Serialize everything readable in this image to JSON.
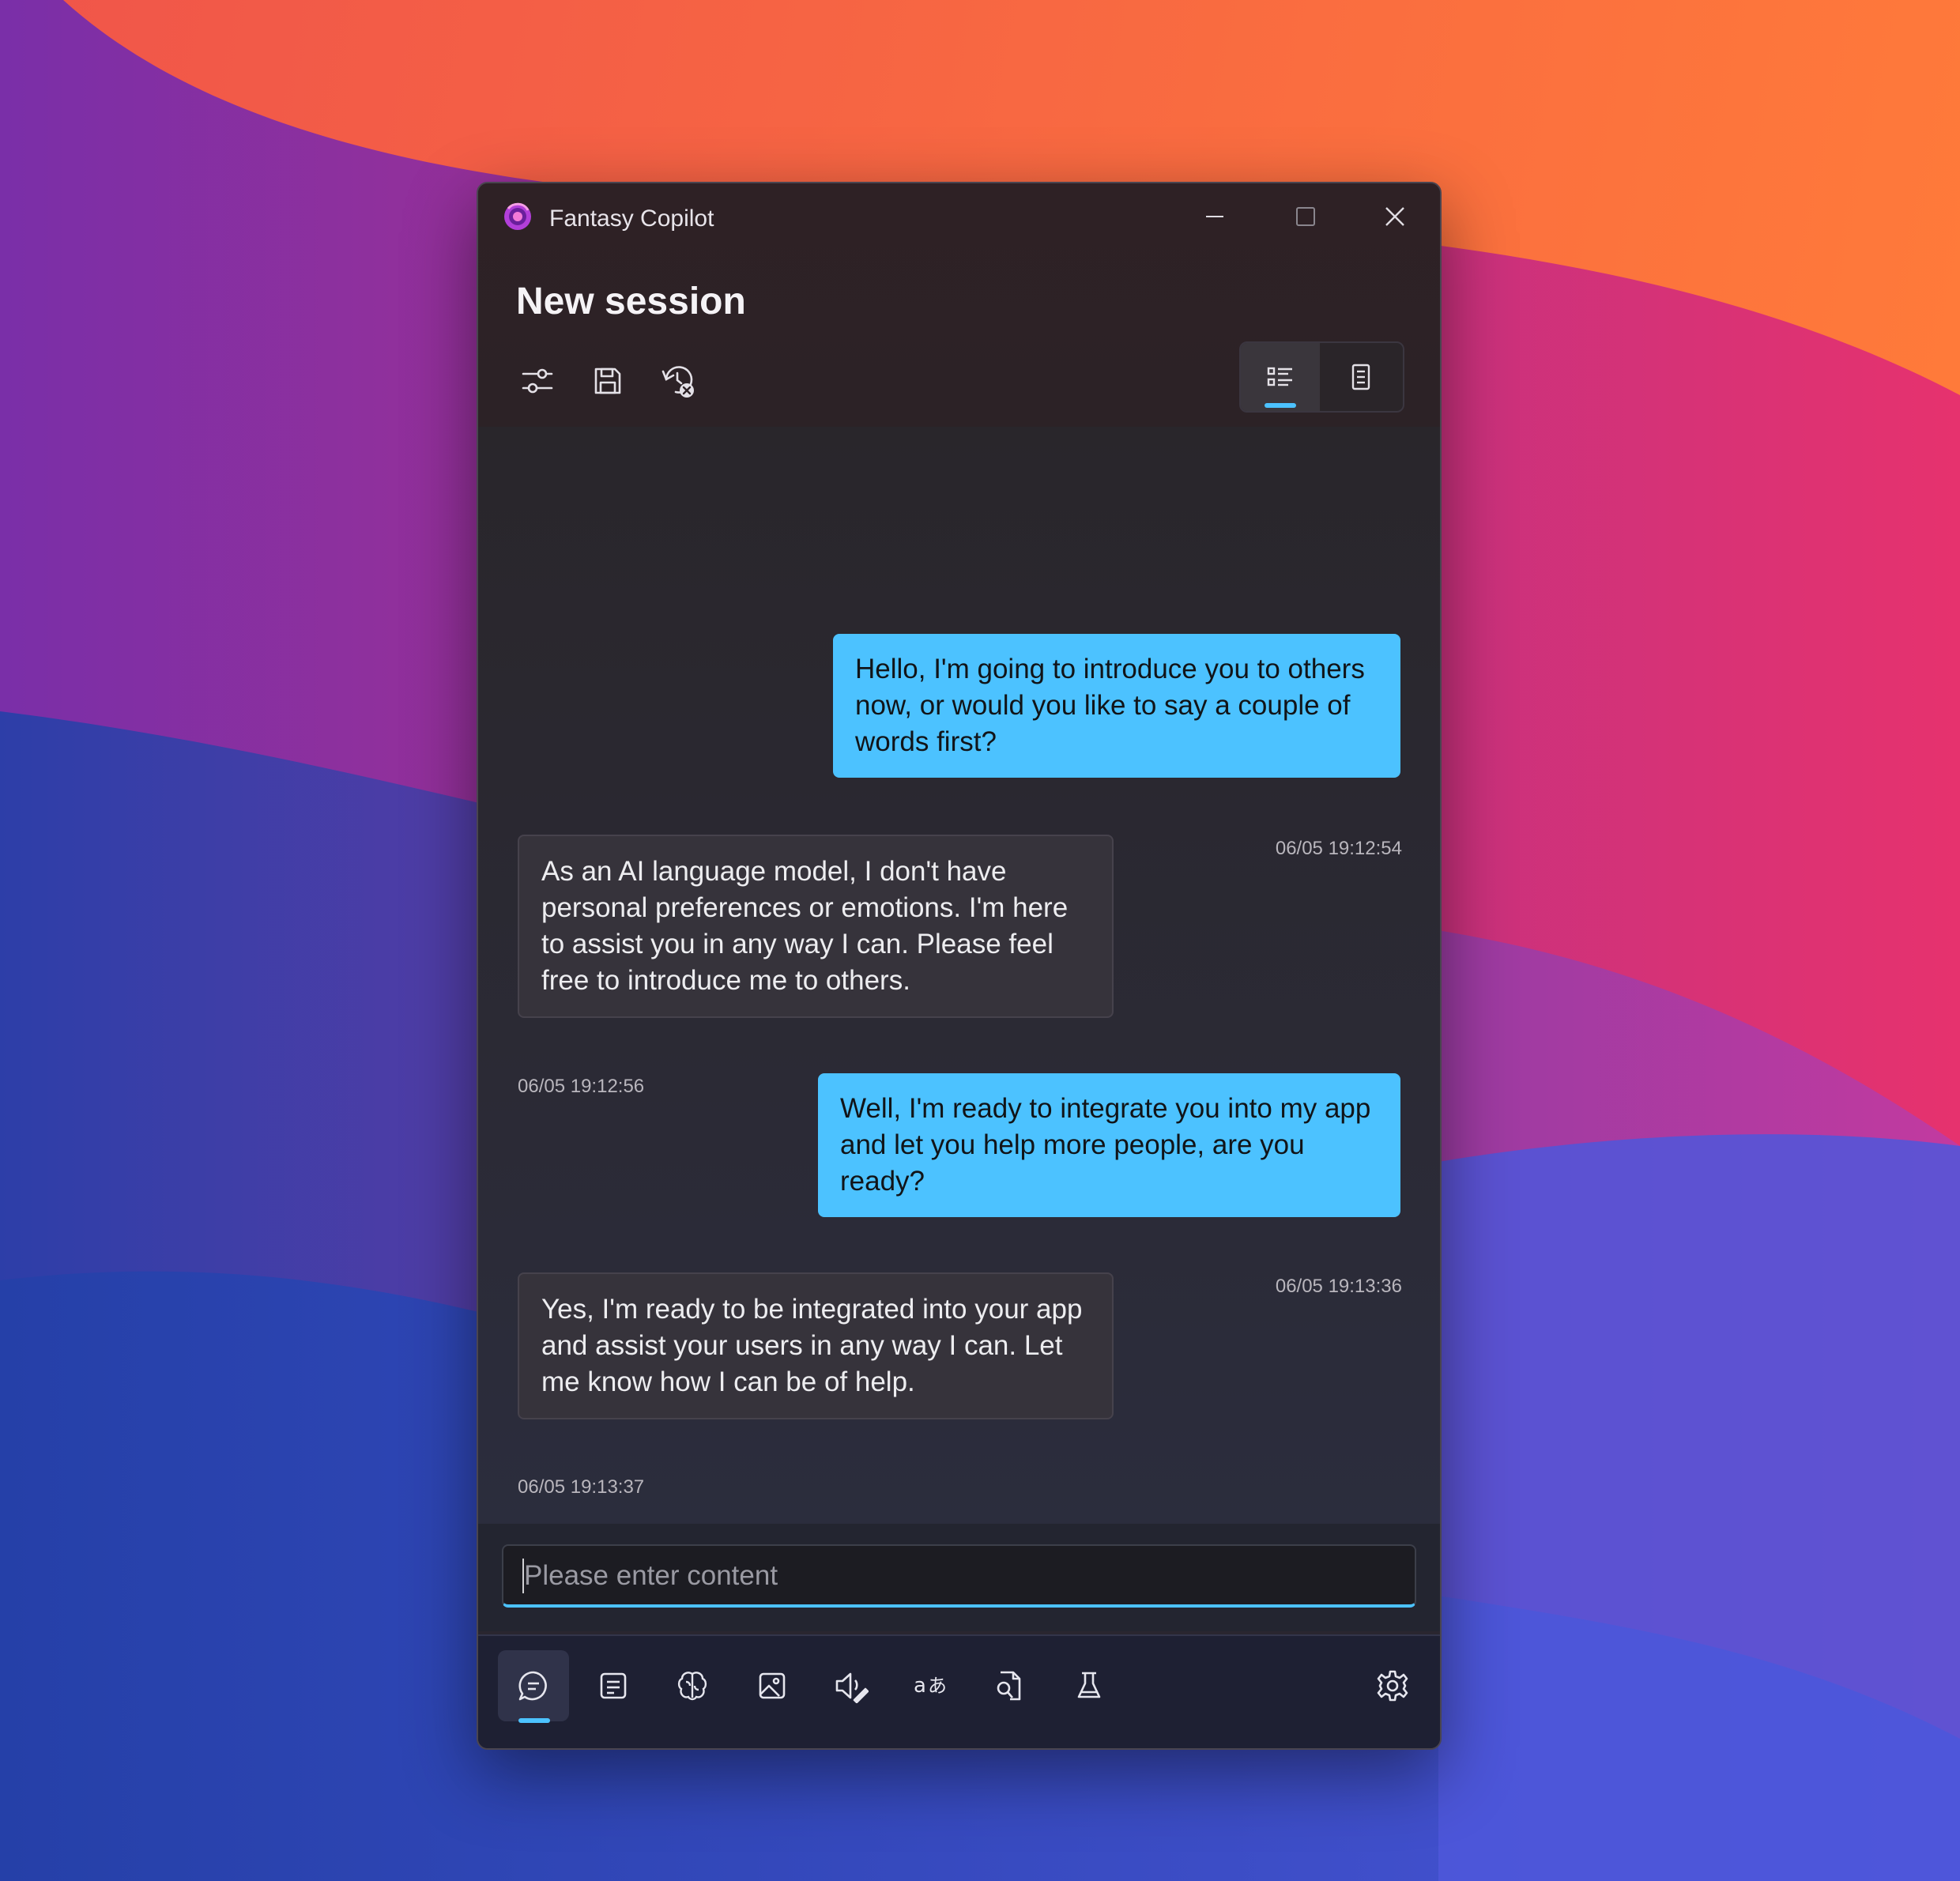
{
  "app": {
    "title": "Fantasy Copilot",
    "logo": "fantasy-copilot-logo"
  },
  "window_controls": {
    "minimize": "minimize-icon",
    "maximize": "maximize-icon",
    "close": "close-icon"
  },
  "header": {
    "title": "New session"
  },
  "toolbar": {
    "items": [
      "sliders-icon",
      "save-icon",
      "history-clear-icon"
    ],
    "view_toggle": {
      "items": [
        "list-view-icon",
        "document-view-icon"
      ],
      "selected": 0
    }
  },
  "messages": [
    {
      "role": "user",
      "text": "Hello, I'm going to introduce you to others now, or would you like to say a couple of words first?",
      "time": "06/05 19:12:54"
    },
    {
      "role": "assistant",
      "text": "As an AI language model, I don't have personal preferences or emotions. I'm here to assist you in any way I can. Please feel free to introduce me to others.",
      "time": "06/05 19:12:56"
    },
    {
      "role": "user",
      "text": "Well, I'm ready to integrate you into my app and let you help more people, are you ready?",
      "time": "06/05 19:13:36"
    },
    {
      "role": "assistant",
      "text": "Yes, I'm ready to be integrated into your app and assist your users in any way I can. Let me know how I can be of help.",
      "time": "06/05 19:13:37"
    }
  ],
  "input": {
    "placeholder": "Please enter content",
    "value": ""
  },
  "nav": {
    "items": [
      "chat-icon",
      "notes-icon",
      "knowledge-icon",
      "image-icon",
      "voice-icon",
      "translate-icon",
      "file-search-icon",
      "lab-icon"
    ],
    "selected": 0,
    "settings": "settings-icon"
  },
  "colors": {
    "accent": "#4cc2ff",
    "user_bubble": "#4cc2ff",
    "assistant_bubble": "#36333b"
  }
}
